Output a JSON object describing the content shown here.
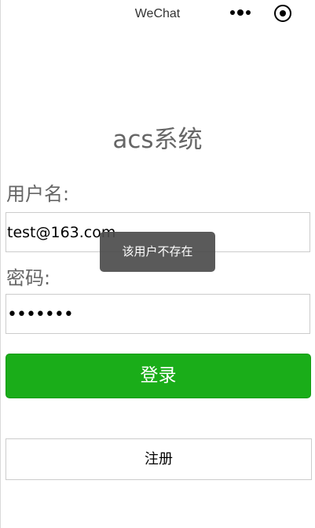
{
  "nav": {
    "title": "WeChat",
    "more_icon": "more-dots-icon",
    "close_icon": "target-close-icon"
  },
  "page": {
    "title": "acs系统"
  },
  "form": {
    "username_label": "用户名:",
    "username_value": "test@163.com",
    "password_label": "密码:",
    "password_value": "•••••••"
  },
  "buttons": {
    "login_label": "登录",
    "register_label": "注册"
  },
  "toast": {
    "message": "该用户不存在"
  },
  "colors": {
    "primary_green": "#1aad19",
    "label_gray": "#666666",
    "toast_bg": "#4c4c4c"
  }
}
